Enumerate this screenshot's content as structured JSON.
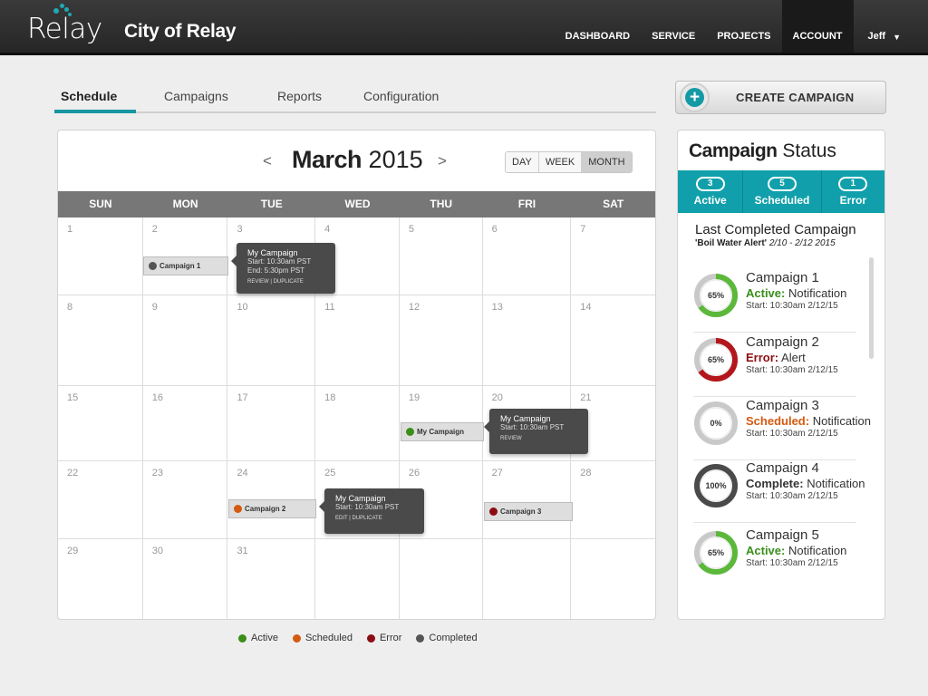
{
  "brand": {
    "logo": "Relay",
    "city": "City of Relay",
    "accent": "#1796a1"
  },
  "nav": {
    "items": [
      "DASHBOARD",
      "SERVICE",
      "PROJECTS",
      "ACCOUNT"
    ],
    "active": "ACCOUNT",
    "user": "Jeff"
  },
  "tabs": [
    "Schedule",
    "Campaigns",
    "Reports",
    "Configuration"
  ],
  "active_tab": "Schedule",
  "create_button": "CREATE CAMPAIGN",
  "calendar": {
    "month": "March",
    "year": "2015",
    "prev": "<",
    "next": ">",
    "views": [
      "DAY",
      "WEEK",
      "MONTH"
    ],
    "active_view": "MONTH",
    "weekdays": [
      "SUN",
      "MON",
      "TUE",
      "WED",
      "THU",
      "FRI",
      "SAT"
    ],
    "weeks": [
      [
        "1",
        "2",
        "3",
        "4",
        "5",
        "6",
        "7"
      ],
      [
        "8",
        "9",
        "10",
        "11",
        "12",
        "13",
        "14"
      ],
      [
        "15",
        "16",
        "17",
        "18",
        "19",
        "20",
        "21"
      ],
      [
        "22",
        "23",
        "24",
        "25",
        "26",
        "27",
        "28"
      ],
      [
        "29",
        "30",
        "31",
        "",
        "",
        "",
        ""
      ]
    ],
    "events": [
      {
        "label": "Campaign 1",
        "status": "Completed",
        "color": "#555555"
      },
      {
        "label": "My Campaign",
        "status": "Active",
        "color": "#3a8e1a"
      },
      {
        "label": "Campaign 2",
        "status": "Scheduled",
        "color": "#d35a10"
      },
      {
        "label": "Campaign 3",
        "status": "Error",
        "color": "#8b0d12"
      }
    ],
    "popups": [
      {
        "title": "My Campaign",
        "line1": "Start: 10:30am PST",
        "line2": "End: 5:30pm PST",
        "links": [
          "REVIEW",
          "DUPLICATE"
        ]
      },
      {
        "title": "My Campaign",
        "line1": "Start: 10:30am PST",
        "line2": "",
        "links": [
          "REVIEW"
        ]
      },
      {
        "title": "My Campaign",
        "line1": "Start: 10:30am PST",
        "line2": "",
        "links": [
          "EDIT",
          "DUPLICATE"
        ]
      }
    ]
  },
  "legend": [
    {
      "label": "Active",
      "color": "#3a8e1a"
    },
    {
      "label": "Scheduled",
      "color": "#d35a10"
    },
    {
      "label": "Error",
      "color": "#8b0d12"
    },
    {
      "label": "Completed",
      "color": "#555555"
    }
  ],
  "status_panel": {
    "title_bold": "Campaign",
    "title_rest": " Status",
    "counts": [
      {
        "count": "3",
        "label": "Active"
      },
      {
        "count": "5",
        "label": "Scheduled"
      },
      {
        "count": "1",
        "label": "Error"
      }
    ],
    "last_completed_heading": "Last Completed Campaign",
    "last_completed_name": "'Boil Water Alert'",
    "last_completed_dates": "2/10 - 2/12 2015",
    "campaigns": [
      {
        "name": "Campaign 1",
        "status": "Active:",
        "type": "Notification",
        "start": "Start: 10:30am 2/12/15",
        "percent": "65%",
        "progress": 0.65,
        "status_color": "#3a8e1a",
        "ring_color": "#5cb83a"
      },
      {
        "name": "Campaign 2",
        "status": "Error:",
        "type": "Alert",
        "start": "Start: 10:30am 2/12/15",
        "percent": "65%",
        "progress": 0.65,
        "status_color": "#8b0d12",
        "ring_color": "#b3161c"
      },
      {
        "name": "Campaign 3",
        "status": "Scheduled:",
        "type": "Notification",
        "start": "Start: 10:30am 2/12/15",
        "percent": "0%",
        "progress": 0,
        "status_color": "#d35a10",
        "ring_color": "#d35a10"
      },
      {
        "name": "Campaign 4",
        "status": "Complete:",
        "type": "Notification",
        "start": "Start: 10:30am 2/12/15",
        "percent": "100%",
        "progress": 1,
        "status_color": "#333333",
        "ring_color": "#4a4a4a"
      },
      {
        "name": "Campaign 5",
        "status": "Active:",
        "type": "Notification",
        "start": "Start: 10:30am 2/12/15",
        "percent": "65%",
        "progress": 0.65,
        "status_color": "#3a8e1a",
        "ring_color": "#5cb83a"
      }
    ]
  }
}
